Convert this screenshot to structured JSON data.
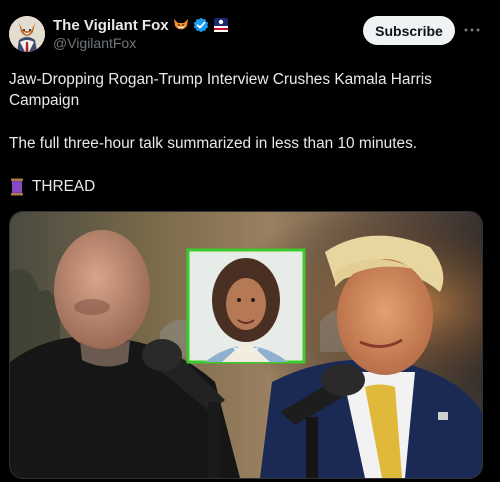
{
  "author": {
    "display_name": "The Vigilant Fox",
    "handle": "@VigilantFox",
    "avatar_icon": "fox-avatar-icon",
    "badges": [
      "fox-emoji-icon",
      "verified-badge-icon",
      "affiliate-badge-icon"
    ]
  },
  "actions": {
    "subscribe_label": "Subscribe",
    "more_icon": "more-dots-icon"
  },
  "tweet": {
    "line1": "Jaw-Dropping Rogan-Trump Interview Crushes Kamala Harris",
    "line2": "Campaign",
    "line3": "The full three-hour talk summarized in less than 10 minutes.",
    "thread_icon": "thread-spool-icon",
    "thread_label": "THREAD"
  },
  "media": {
    "image_icon": "interview-photo-image"
  },
  "colors": {
    "background": "#000000",
    "text": "#e7e9ea",
    "secondary_text": "#71767b",
    "verified": "#1d9bf0",
    "subscribe_bg": "#eff3f4",
    "inset_border": "#3ccb2c"
  }
}
